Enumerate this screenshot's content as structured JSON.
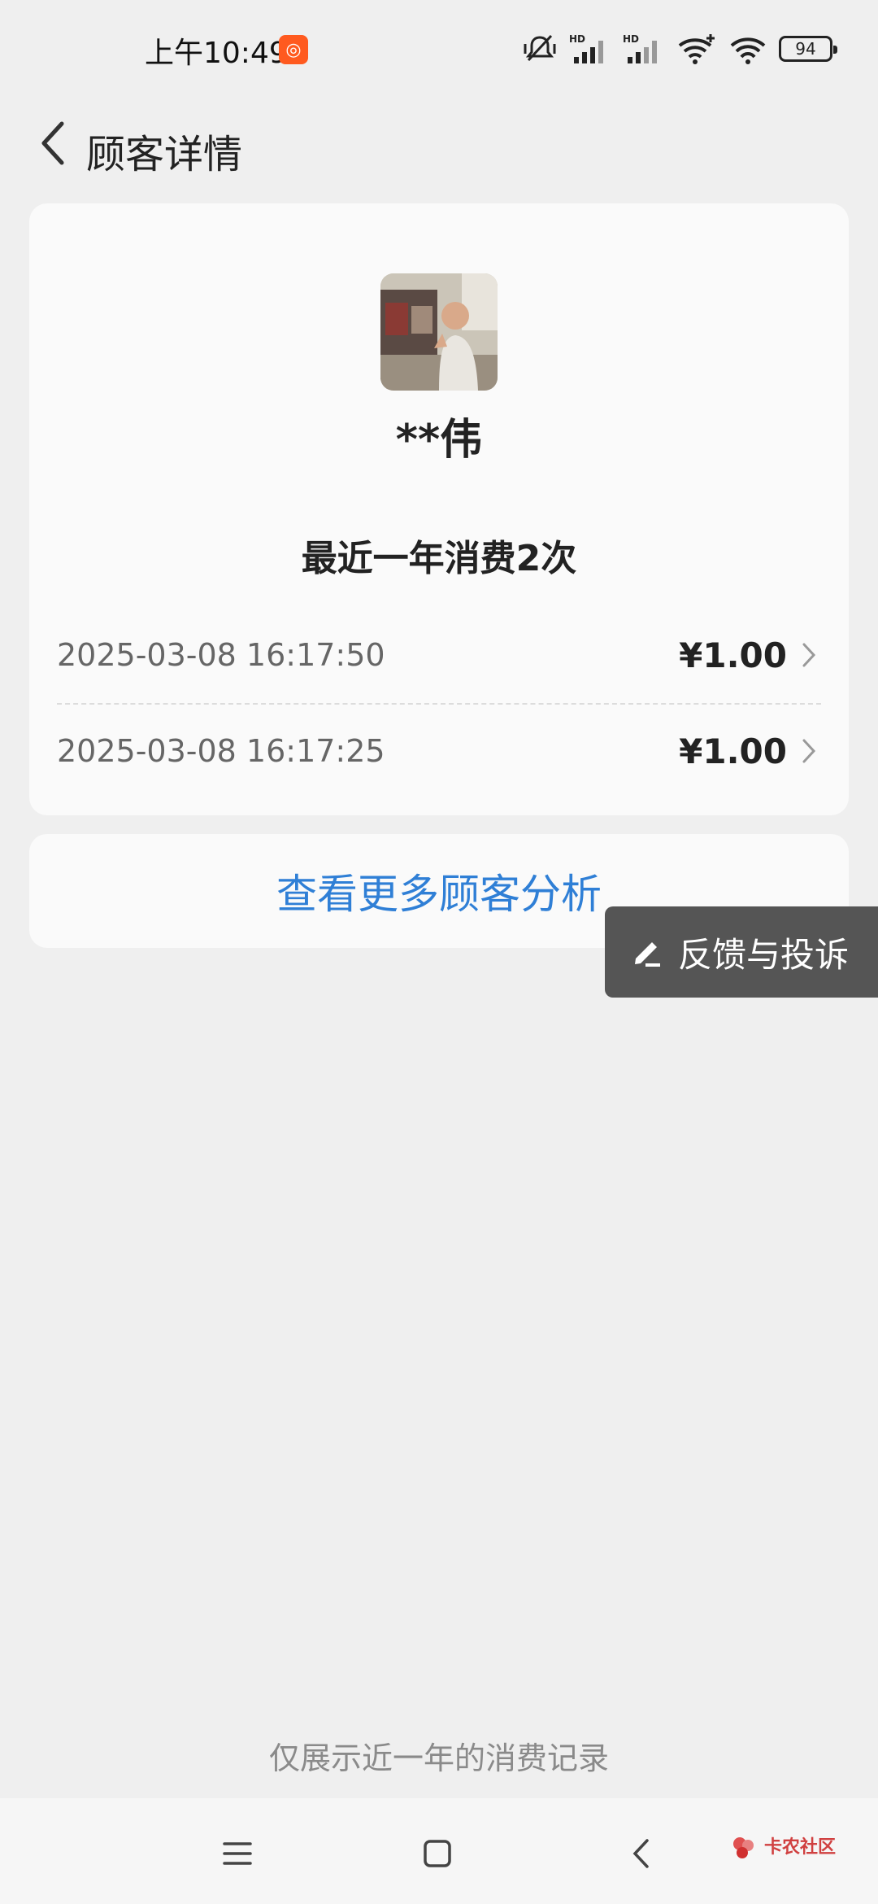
{
  "status_bar": {
    "time": "上午10:49",
    "battery": "94",
    "signal_label_1": "HD",
    "signal_label_2": "HD"
  },
  "header": {
    "title": "顾客详情"
  },
  "customer": {
    "name": "**伟",
    "summary": "最近一年消费2次"
  },
  "records": [
    {
      "datetime": "2025-03-08 16:17:50",
      "amount": "¥1.00"
    },
    {
      "datetime": "2025-03-08 16:17:25",
      "amount": "¥1.00"
    }
  ],
  "more_link": "查看更多顾客分析",
  "feedback": {
    "label": "反馈与投诉"
  },
  "footnote": "仅展示近一年的消费记录",
  "watermark": {
    "text": "卡农社区"
  },
  "colors": {
    "background": "#efefef",
    "card": "#fafafa",
    "link": "#2f7fd6",
    "feedback_bg": "#555555",
    "app_badge": "#ff5a1f"
  }
}
